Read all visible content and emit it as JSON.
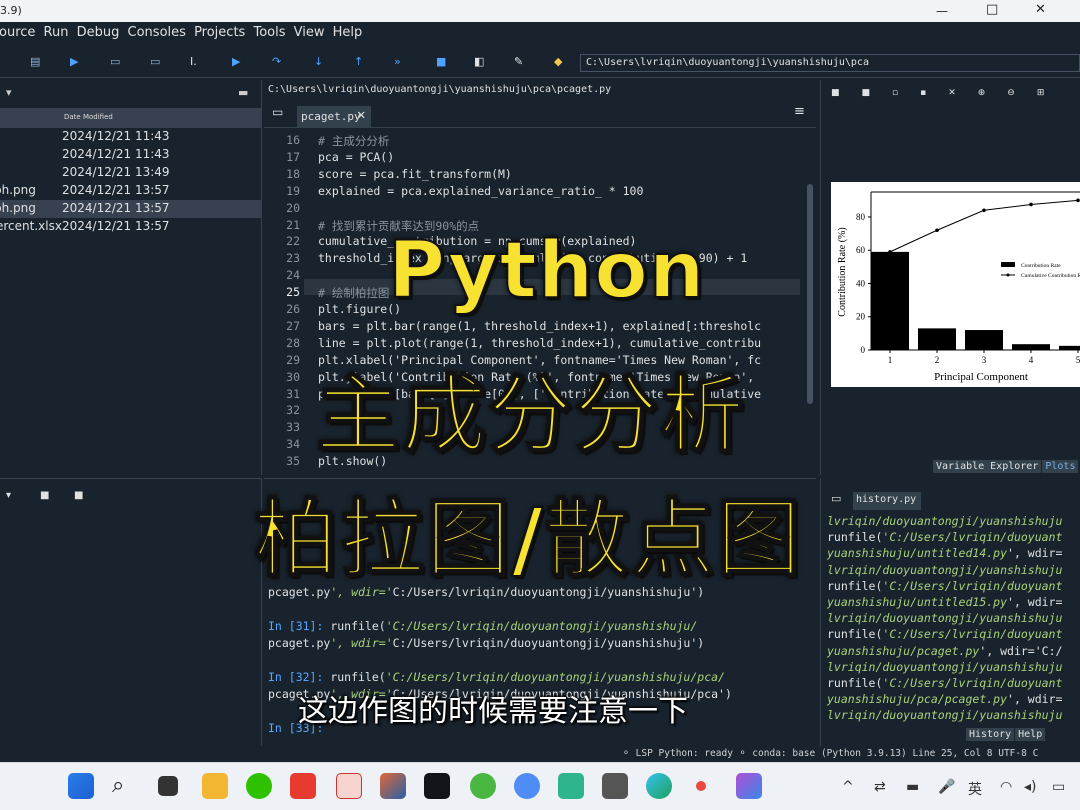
{
  "window": {
    "title_fragment": "3.9)"
  },
  "menu": [
    "ource",
    "Run",
    "Debug",
    "Consoles",
    "Projects",
    "Tools",
    "View",
    "Help"
  ],
  "toolbar": {
    "path": "C:\\Users\\lvriqin\\duoyuantongji\\yuanshishuju\\pca"
  },
  "files": {
    "column_header": "Date Modified",
    "rows": [
      {
        "name": "",
        "date": "2024/12/21 11:43",
        "selected": false
      },
      {
        "name": "",
        "date": "2024/12/21 11:43",
        "selected": false
      },
      {
        "name": "",
        "date": "2024/12/21 13:49",
        "selected": false
      },
      {
        "name": "ph.png",
        "date": "2024/12/21 13:57",
        "selected": false
      },
      {
        "name": "ph.png",
        "date": "2024/12/21 13:57",
        "selected": true
      },
      {
        "name": "ercent.xlsx",
        "date": "2024/12/21 13:57",
        "selected": false
      }
    ]
  },
  "editor": {
    "path": "C:\\Users\\lvriqin\\duoyuantongji\\yuanshishuju\\pca\\pcaget.py",
    "tab": "pcaget.py",
    "lines": [
      {
        "n": "16",
        "code": "# 主成分分析",
        "comment": true
      },
      {
        "n": "17",
        "code": "pca = PCA()",
        "comment": false
      },
      {
        "n": "18",
        "code": "score = pca.fit_transform(M)",
        "comment": false
      },
      {
        "n": "19",
        "code": "explained = pca.explained_variance_ratio_ * 100",
        "comment": false
      },
      {
        "n": "20",
        "code": "",
        "comment": false
      },
      {
        "n": "21",
        "code": "# 找到累计贡献率达到90%的点",
        "comment": true
      },
      {
        "n": "22",
        "code": "cumulative_contribution = np.cumsum(explained)",
        "comment": false
      },
      {
        "n": "23",
        "code": "threshold_index = np.argmax(cumulative_contribution >= 90) + 1",
        "comment": false
      },
      {
        "n": "24",
        "code": "",
        "comment": false
      },
      {
        "n": "25",
        "code": "# 绘制柏拉图",
        "comment": true
      },
      {
        "n": "26",
        "code": "plt.figure()",
        "comment": false
      },
      {
        "n": "27",
        "code": "bars = plt.bar(range(1, threshold_index+1), explained[:thresholc",
        "comment": false
      },
      {
        "n": "28",
        "code": "line = plt.plot(range(1, threshold_index+1), cumulative_contribu",
        "comment": false
      },
      {
        "n": "29",
        "code": "plt.xlabel('Principal Component', fontname='Times New Roman', fc",
        "comment": false
      },
      {
        "n": "30",
        "code": "plt.ylabel('Contribution Rate (%)', fontname='Times New Roman',",
        "comment": false
      },
      {
        "n": "31",
        "code": "plt.legend([bars[0], line[0]], ['Contribution Rate', 'Cumulative",
        "comment": false
      },
      {
        "n": "32",
        "code": "",
        "comment": false
      },
      {
        "n": "33",
        "code": "",
        "comment": false
      },
      {
        "n": "34",
        "code": "",
        "comment": false
      },
      {
        "n": "35",
        "code": "plt.show()",
        "comment": false
      }
    ]
  },
  "console": {
    "lines": [
      {
        "prompt": "",
        "text": "pcaget.py', wdir='C:/Users/lvriqin/duoyuantongji/yuanshishuju')"
      },
      {
        "prompt": "",
        "text": ""
      },
      {
        "prompt": "In [31]: ",
        "text": "runfile('C:/Users/lvriqin/duoyuantongji/yuanshishuju/"
      },
      {
        "prompt": "",
        "text": "pcaget.py', wdir='C:/Users/lvriqin/duoyuantongji/yuanshishuju')"
      },
      {
        "prompt": "",
        "text": ""
      },
      {
        "prompt": "In [32]: ",
        "text": "runfile('C:/Users/lvriqin/duoyuantongji/yuanshishuju/pca/"
      },
      {
        "prompt": "",
        "text": "pcaget.py', wdir='C:/Users/lvriqin/duoyuantongji/yuanshishuju/pca')"
      },
      {
        "prompt": "",
        "text": ""
      },
      {
        "prompt": "In [33]: ",
        "text": ""
      }
    ]
  },
  "plots": {
    "tabs": [
      "Variable Explorer",
      "Plots"
    ],
    "chart_data": {
      "type": "bar",
      "categories": [
        "1",
        "2",
        "3",
        "4",
        "5"
      ],
      "series": [
        {
          "name": "Contribution Rate",
          "values": [
            59,
            13,
            12,
            3.5,
            2.5
          ]
        },
        {
          "name": "Cumulative Contribution Rate",
          "values": [
            59,
            72,
            84,
            87.5,
            90
          ]
        }
      ],
      "xlabel": "Principal Component",
      "ylabel": "Contribution Rate (%)",
      "yticks": [
        "0",
        "20",
        "40",
        "60",
        "80"
      ],
      "ylim": [
        0,
        95
      ],
      "legend_labels": [
        "Contribution Rate",
        "Cumulative Contribution Rate"
      ]
    }
  },
  "history": {
    "tab": "history.py",
    "lines": [
      {
        "a": "lvriqin/duoyuantongji/yuanshishuju",
        "t": "st"
      },
      {
        "a": "runfile(",
        "b": "'C:/Users/lvriqin/duoyuant",
        "t": "mix"
      },
      {
        "a": "yuanshishuju/untitled14.py",
        "b": "', wdir=",
        "t": "mix2"
      },
      {
        "a": "lvriqin/duoyuantongji/yuanshishuju",
        "t": "st"
      },
      {
        "a": "runfile(",
        "b": "'C:/Users/lvriqin/duoyuant",
        "t": "mix"
      },
      {
        "a": "yuanshishuju/untitled15.py",
        "b": "', wdir=",
        "t": "mix2"
      },
      {
        "a": "lvriqin/duoyuantongji/yuanshishuju",
        "t": "st"
      },
      {
        "a": "runfile(",
        "b": "'C:/Users/lvriqin/duoyuant",
        "t": "mix"
      },
      {
        "a": "yuanshishuju/pcaget.py",
        "b": "', wdir='C:/",
        "t": "mix2"
      },
      {
        "a": "lvriqin/duoyuantongji/yuanshishuju",
        "t": "st"
      },
      {
        "a": "runfile(",
        "b": "'C:/Users/lvriqin/duoyuant",
        "t": "mix"
      },
      {
        "a": "yuanshishuju/pca/pcaget.py",
        "b": "', wdir=",
        "t": "mix2"
      },
      {
        "a": "lvriqin/duoyuantongji/yuanshishuju",
        "t": "st"
      }
    ],
    "bottom_tabs": [
      "History",
      "Help"
    ]
  },
  "status": {
    "text": "⚬ LSP Python: ready  ⚬ conda: base (Python 3.9.13)  Line 25, Col 8  UTF-8  C"
  },
  "overlay": {
    "title1": "Python",
    "title2": "主成分分析",
    "title3": "柏拉图/散点图",
    "subtitle": "这边作图的时候需要注意一下"
  },
  "taskbar": {
    "lang": "英",
    "icons": [
      "windows-start",
      "search",
      "task-view",
      "file-explorer",
      "wechat",
      "wps",
      "kingsoft-app",
      "matlab",
      "terminal",
      "qq-app",
      "baidu-netdisk",
      "remote-app",
      "document-app",
      "edge",
      "recorder",
      "spyder"
    ]
  }
}
